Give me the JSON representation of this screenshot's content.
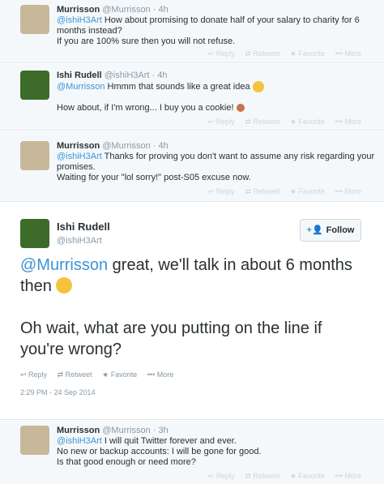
{
  "tweets": [
    {
      "name": "Murrisson",
      "handle": "@Murrisson",
      "dot": "·",
      "time": "4h",
      "mention": "@ishiH3Art",
      "line1": " How about promising to donate half of your salary to charity for 6",
      "line2": "months instead?",
      "line3": "If you are 100% sure then you will not refuse."
    },
    {
      "name": "Ishi Rudell",
      "handle": "@ishiH3Art",
      "dot": "·",
      "time": "4h",
      "mention": "@Murrisson",
      "line1": " Hmmm that sounds like a great idea ",
      "line2": "How about, if I'm wrong... I buy you a cookie! "
    },
    {
      "name": "Murrisson",
      "handle": "@Murrisson",
      "dot": "·",
      "time": "4h",
      "mention": "@ishiH3Art",
      "line1": " Thanks for proving you don't want to assume any risk regarding your",
      "line2": "promises.",
      "line3": "Waiting for your \"lol sorry!\" post-S05 excuse now."
    },
    {
      "name": "Murrisson",
      "handle": "@Murrisson",
      "dot": "·",
      "time": "3h",
      "mention": "@ishiH3Art",
      "line1": " I will quit Twitter forever and ever.",
      "line2": "No new or backup accounts: I will be gone for good.",
      "line3": "Is that good enough or need more?"
    }
  ],
  "actions": {
    "reply": "Reply",
    "retweet": "Retweet",
    "favorite": "Favorite",
    "more": "More",
    "reply_icon": "reply-icon",
    "retweet_icon": "retweet-icon",
    "favorite_icon": "star-icon",
    "more_icon": "more-dots-icon"
  },
  "main_tweet": {
    "name": "Ishi Rudell",
    "handle": "@ishiH3Art",
    "follow_label": "Follow",
    "mention": "@Murrisson",
    "text1": " great, we'll talk in about 6 months then ",
    "text2": "Oh wait, what are you putting on the line if you're wrong?",
    "timestamp": "2:29 PM - 24 Sep 2014"
  },
  "colors": {
    "link": "#3b94d9",
    "muted": "#8899a6",
    "text": "#292f33"
  }
}
